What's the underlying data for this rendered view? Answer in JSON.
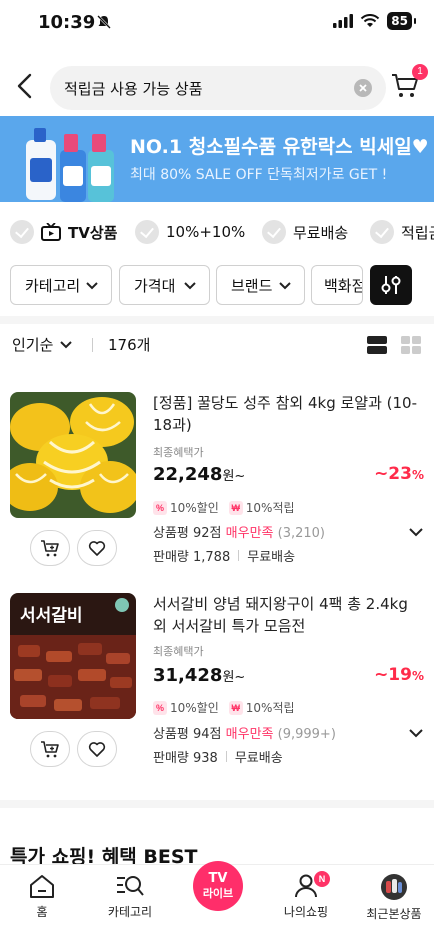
{
  "status_bar": {
    "time": "10:39",
    "battery": "85"
  },
  "search": {
    "value": "적립금 사용 가능 상품",
    "cart_badge": "1"
  },
  "banner": {
    "title": "NO.1 청소필수품 유한락스 빅세일♥",
    "subtitle": "최대 80% SALE OFF 단독최저가로 GET !",
    "background": "#5aa7ec"
  },
  "chips": [
    {
      "label": "TV상품"
    },
    {
      "label": "10%+10%"
    },
    {
      "label": "무료배송"
    },
    {
      "label": "적립금"
    }
  ],
  "filters": [
    {
      "label": "카테고리"
    },
    {
      "label": "가격대"
    },
    {
      "label": "브랜드"
    },
    {
      "label": "백화점"
    }
  ],
  "sort": {
    "label": "인기순",
    "count": "176개"
  },
  "products": [
    {
      "name": "[정품] 꿀당도 성주 참외 4kg 로얄과 (10-18과)",
      "price_label": "최종혜택가",
      "price": "22,248",
      "currency": "원~",
      "discount": "~23",
      "discount_unit": "%",
      "tag_discount": "10%할인",
      "tag_points": "10%적립",
      "rating_prefix": "상품평 92점",
      "rating_grade": "매우만족",
      "rating_count": "(3,210)",
      "sales": "판매량 1,788",
      "shipping": "무료배송"
    },
    {
      "name": "서서갈비 양념 돼지왕구이 4팩 총 2.4kg 외 서서갈비 특가 모음전",
      "price_label": "최종혜택가",
      "price": "31,428",
      "currency": "원~",
      "discount": "~19",
      "discount_unit": "%",
      "tag_discount": "10%할인",
      "tag_points": "10%적립",
      "rating_prefix": "상품평 94점",
      "rating_grade": "매우만족",
      "rating_count": "(9,999+)",
      "sales": "판매량 938",
      "shipping": "무료배송",
      "image_text": "서서갈비"
    }
  ],
  "section_title": "특가 쇼핑! 혜택 BEST",
  "bottom_nav": {
    "home": "홈",
    "category": "카테고리",
    "tv_line1": "TV",
    "tv_line2": "라이브",
    "my": "나의쇼핑",
    "my_badge": "N",
    "recent": "최근본상품"
  },
  "colors": {
    "accent": "#ff3366",
    "discount": "#ff2b4a"
  }
}
